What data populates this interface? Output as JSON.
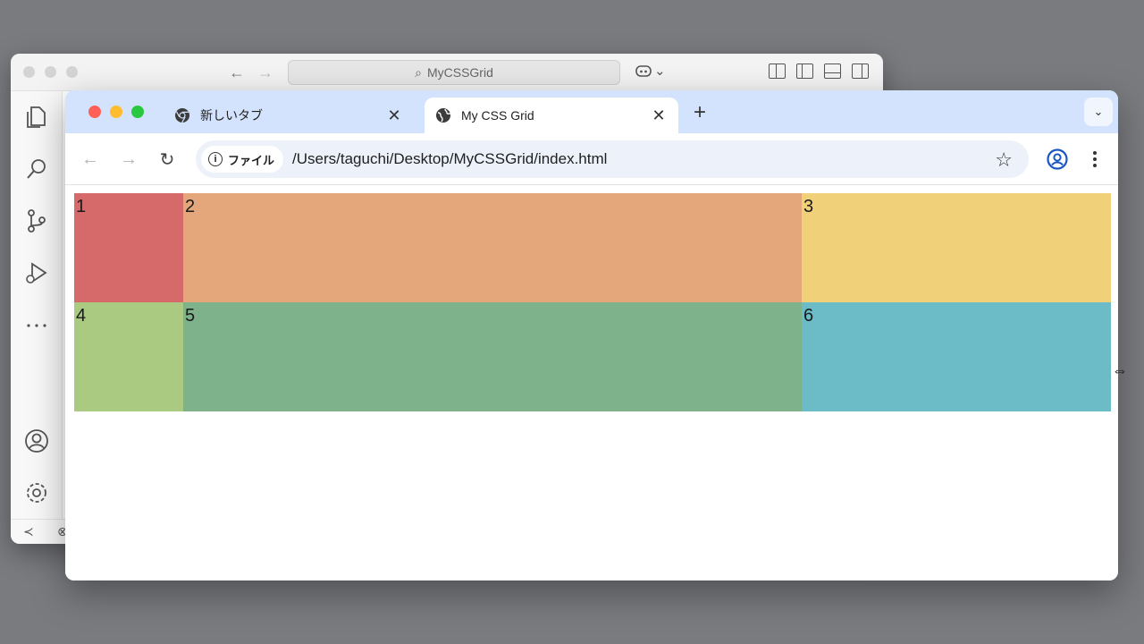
{
  "editor_window": {
    "search_text": "MyCSSGrid",
    "nav_back": "←",
    "nav_forward": "→",
    "copilot": "⌄",
    "statusbar": {
      "remote": "≺",
      "problems": "⊗"
    }
  },
  "browser": {
    "tabs": [
      {
        "title": "新しいタブ",
        "close": "✕",
        "active": false
      },
      {
        "title": "My CSS Grid",
        "close": "✕",
        "active": true
      }
    ],
    "new_tab": "+",
    "tab_search": "⌄",
    "toolbar": {
      "back": "←",
      "forward": "→",
      "reload": "↻",
      "chip_label": "ファイル",
      "chip_icon": "i",
      "url": "/Users/taguchi/Desktop/MyCSSGrid/index.html",
      "bookmark": "☆"
    }
  },
  "grid": {
    "cells": [
      {
        "label": "1",
        "color": "#d66a6a"
      },
      {
        "label": "2",
        "color": "#e4a77b"
      },
      {
        "label": "3",
        "color": "#f1d07a"
      },
      {
        "label": "4",
        "color": "#a9ca80"
      },
      {
        "label": "5",
        "color": "#7db28b"
      },
      {
        "label": "6",
        "color": "#6bbcc7"
      }
    ]
  },
  "cursor": "⇔"
}
